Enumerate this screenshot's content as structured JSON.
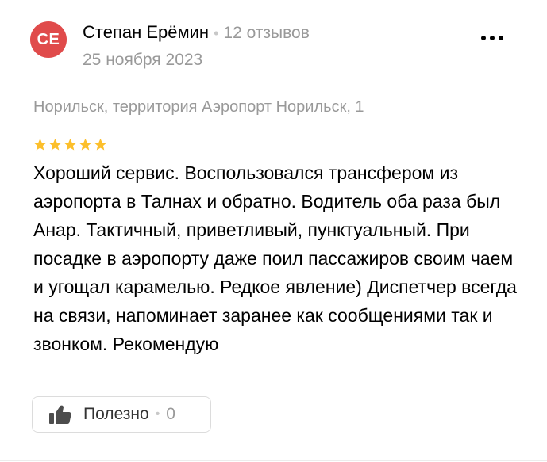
{
  "author": {
    "initials": "СЕ",
    "name": "Степан Ерёмин",
    "reviews_count": "12 отзывов",
    "avatar_color": "#e04b4b"
  },
  "review": {
    "date": "25 ноября 2023",
    "address": "Норильск, территория Аэропорт Норильск, 1",
    "rating": 5,
    "star_color": "#fcbf2b",
    "text": "Хороший сервис. Воспользовался трансфером из аэропорта в Талнах и обратно. Водитель оба раза был Анар. Тактичный, приветливый, пунктуальный. При посадке в аэропорту даже поил пассажиров своим чаем и угощал карамелью. Редкое явление) Диспетчер всегда на связи, напоминает заранее как сообщениями так и звонком. Рекомендую"
  },
  "actions": {
    "more_icon": "more-dots-icon",
    "useful_label": "Полезно",
    "useful_count": "0",
    "thumb_icon": "thumbs-up-icon"
  }
}
